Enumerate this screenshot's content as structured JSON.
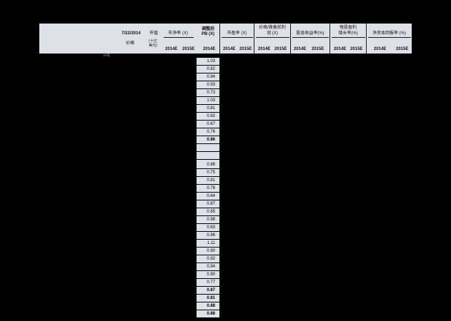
{
  "header": {
    "date": "7/22/2014",
    "market_cap": "市值",
    "price": "价格",
    "cap_unit": "(十亿美元)",
    "rating": "评级",
    "pb_label": "市净率 (X)",
    "adj_pb_line1": "调整后",
    "adj_pb_line2": "PB (X)",
    "pe_label": "市盈率 (X)",
    "ppop_line1": "价格/拨备前利",
    "ppop_line2": "润 (X)",
    "dy_label": "股息收益率(%)",
    "eps_line1": "每股盈利",
    "eps_line2": "增长率(%)",
    "roe_label": "净资本回报率 (%)",
    "years": [
      "2014E",
      "2015E",
      "2014E",
      "2014E",
      "2015E",
      "2014E",
      "2015E",
      "2014E",
      "2015E",
      "2014E",
      "2015E",
      "2014E",
      "2015E"
    ]
  },
  "pb_group1": [
    {
      "v": "1.03",
      "bold": false
    },
    {
      "v": "0.82",
      "bold": false
    },
    {
      "v": "0.94",
      "bold": false
    },
    {
      "v": "0.93",
      "bold": false
    },
    {
      "v": "0.73",
      "bold": false
    },
    {
      "v": "1.03",
      "bold": false
    },
    {
      "v": "0.81",
      "bold": false
    },
    {
      "v": "0.92",
      "bold": false
    },
    {
      "v": "0.67",
      "bold": false
    },
    {
      "v": "0.76",
      "bold": false
    },
    {
      "v": "0.86",
      "bold": true
    },
    {
      "v": "",
      "bold": false
    },
    {
      "v": "",
      "bold": false
    },
    {
      "v": "",
      "bold": false
    }
  ],
  "pb_group2": [
    {
      "v": "0.88",
      "bold": false
    },
    {
      "v": "0.75",
      "bold": false
    },
    {
      "v": "0.81",
      "bold": false
    },
    {
      "v": "0.78",
      "bold": false
    },
    {
      "v": "0.64",
      "bold": false
    },
    {
      "v": "0.87",
      "bold": false
    },
    {
      "v": "0.85",
      "bold": false
    },
    {
      "v": "0.98",
      "bold": false
    },
    {
      "v": "0.83",
      "bold": false
    },
    {
      "v": "0.96",
      "bold": false
    },
    {
      "v": "1.11",
      "bold": false
    },
    {
      "v": "0.90",
      "bold": false
    },
    {
      "v": "0.92",
      "bold": false
    },
    {
      "v": "0.94",
      "bold": false
    },
    {
      "v": "0.90",
      "bold": false
    },
    {
      "v": "0.77",
      "bold": false
    },
    {
      "v": "0.87",
      "bold": true
    },
    {
      "v": "0.81",
      "bold": true
    },
    {
      "v": "0.88",
      "bold": true
    },
    {
      "v": "0.88",
      "bold": true
    }
  ]
}
